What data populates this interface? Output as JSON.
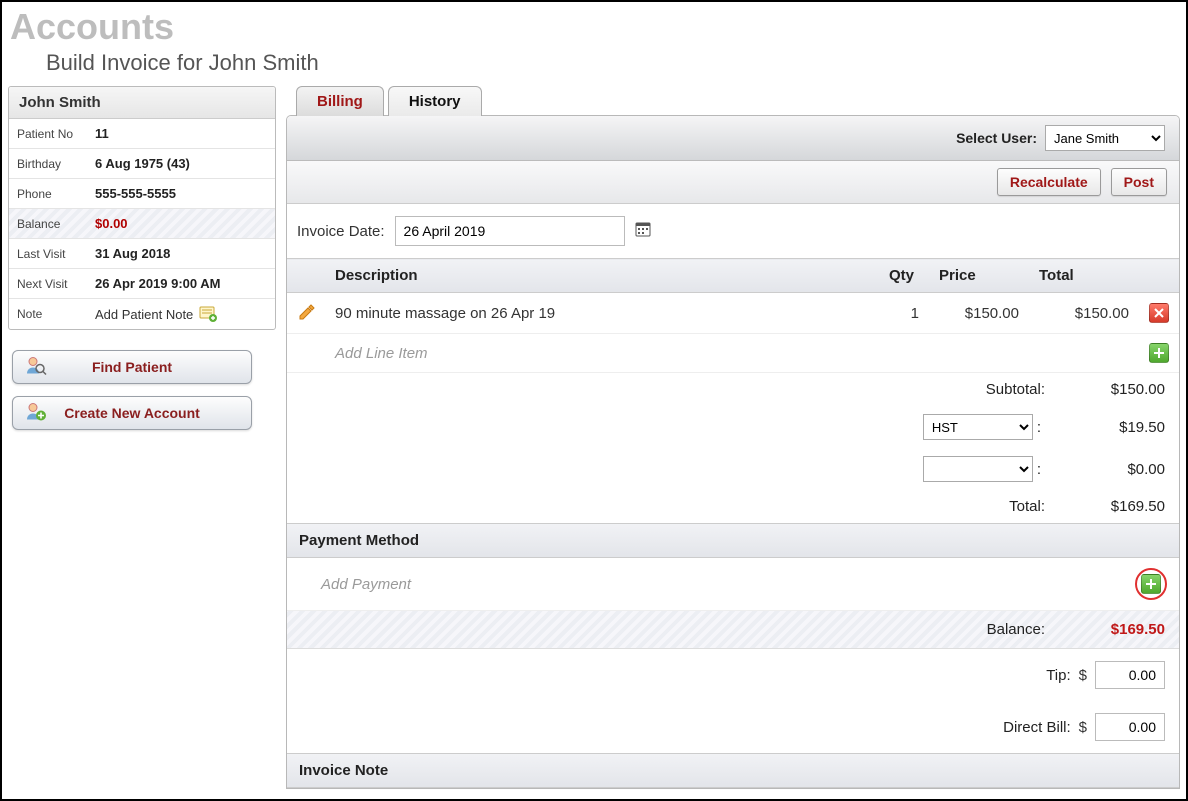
{
  "header": {
    "title": "Accounts",
    "subtitle": "Build Invoice for John Smith"
  },
  "patient": {
    "name": "John Smith",
    "fields": {
      "no_label": "Patient No",
      "no_value": "11",
      "birthday_label": "Birthday",
      "birthday_value": "6 Aug 1975 (43)",
      "phone_label": "Phone",
      "phone_value": "555-555-5555",
      "balance_label": "Balance",
      "balance_value": "$0.00",
      "lastvisit_label": "Last Visit",
      "lastvisit_value": "31 Aug 2018",
      "nextvisit_label": "Next Visit",
      "nextvisit_value": "26 Apr 2019 9:00 AM",
      "note_label": "Note",
      "note_link": "Add Patient Note"
    }
  },
  "sidebar_buttons": {
    "find": "Find Patient",
    "create": "Create New Account"
  },
  "tabs": {
    "billing": "Billing",
    "history": "History"
  },
  "toolbar": {
    "select_user_label": "Select User:",
    "selected_user": "Jane Smith",
    "recalculate": "Recalculate",
    "post": "Post"
  },
  "invoice": {
    "date_label": "Invoice Date:",
    "date_value": "26 April 2019",
    "columns": {
      "description": "Description",
      "qty": "Qty",
      "price": "Price",
      "total": "Total"
    },
    "lines": [
      {
        "description": "90 minute massage on 26 Apr 19",
        "qty": "1",
        "price": "$150.00",
        "total": "$150.00"
      }
    ],
    "add_line_placeholder": "Add Line Item",
    "subtotal_label": "Subtotal:",
    "subtotal_value": "$150.00",
    "tax1_selected": "HST",
    "tax1_value": "$19.50",
    "tax2_selected": "",
    "tax2_value": "$0.00",
    "total_label": "Total:",
    "total_value": "$169.50"
  },
  "payment": {
    "header": "Payment Method",
    "add_placeholder": "Add Payment",
    "balance_label": "Balance:",
    "balance_value": "$169.50",
    "tip_label": "Tip:",
    "tip_value": "0.00",
    "directbill_label": "Direct Bill:",
    "directbill_value": "0.00",
    "currency_symbol": "$"
  },
  "invoice_note_header": "Invoice Note"
}
